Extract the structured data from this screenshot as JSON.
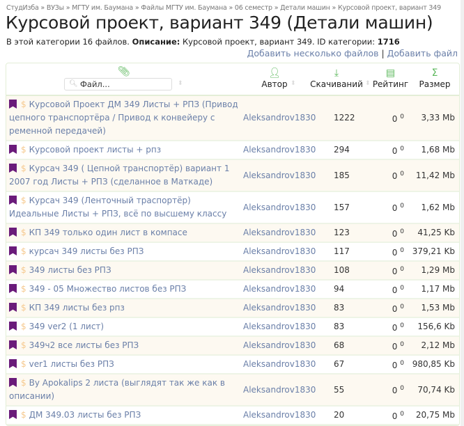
{
  "breadcrumb": [
    "СтудИзба",
    "ВУЗы",
    "МГТУ им. Баумана",
    "Файлы МГТУ им. Баумана",
    "06 семестр",
    "Детали машин",
    "Курсовой проект, вариант 349"
  ],
  "title": "Курсовой проект, вариант 349 (Детали машин)",
  "description": {
    "prefix": "В этой категории 16 файлов. ",
    "label": "Описание:",
    "text": " Курсовой проект, вариант 349. ID категории: ",
    "id": "1716"
  },
  "links": {
    "add_many": "Добавить несколько файлов",
    "sep": " | ",
    "add_one": "Добавить файл"
  },
  "table": {
    "search_placeholder": "Файл...",
    "headers": {
      "author": "Автор",
      "downloads": "Скачиваний",
      "rating": "Рейтинг",
      "size": "Размер"
    },
    "rows": [
      {
        "name": "Курсовой Проект ДМ 349 Листы + РПЗ (Привод цепного транспортёра / Привод к конвейеру с ременной передачей)",
        "author": "Aleksandrov1830",
        "downloads": "1222",
        "rating": "0",
        "votes": "0",
        "size": "3,33 Mb"
      },
      {
        "name": "Курсовой проект листы + рпз",
        "author": "Aleksandrov1830",
        "downloads": "294",
        "rating": "0",
        "votes": "0",
        "size": "1,68 Mb"
      },
      {
        "name": "Курсач 349 ( Цепной транспортёр) вариант 1 2007 год Листы + РПЗ (сделанное в Маткаде)",
        "author": "Aleksandrov1830",
        "downloads": "185",
        "rating": "0",
        "votes": "0",
        "size": "11,42 Mb"
      },
      {
        "name": "Курсач 349 (Ленточный траспортёр) Идеальные Листы + РПЗ, всё по высшему классу",
        "author": "Aleksandrov1830",
        "downloads": "157",
        "rating": "0",
        "votes": "0",
        "size": "1,62 Mb"
      },
      {
        "name": "КП 349 только один лист в компасе",
        "author": "Aleksandrov1830",
        "downloads": "123",
        "rating": "0",
        "votes": "0",
        "size": "41,25 Kb"
      },
      {
        "name": "курсач 349 листы без РПЗ",
        "author": "Aleksandrov1830",
        "downloads": "117",
        "rating": "0",
        "votes": "0",
        "size": "379,21 Kb"
      },
      {
        "name": "349 листы без РПЗ",
        "author": "Aleksandrov1830",
        "downloads": "108",
        "rating": "0",
        "votes": "0",
        "size": "1,29 Mb"
      },
      {
        "name": "349 - 05 Множество листов без РПЗ",
        "author": "Aleksandrov1830",
        "downloads": "94",
        "rating": "0",
        "votes": "0",
        "size": "1,17 Mb"
      },
      {
        "name": "КП 349 листы без рпз",
        "author": "Aleksandrov1830",
        "downloads": "83",
        "rating": "0",
        "votes": "0",
        "size": "1,53 Mb"
      },
      {
        "name": "349 ver2 (1 лист)",
        "author": "Aleksandrov1830",
        "downloads": "83",
        "rating": "0",
        "votes": "0",
        "size": "156,6 Kb"
      },
      {
        "name": "349ч2 все листы без РПЗ",
        "author": "Aleksandrov1830",
        "downloads": "68",
        "rating": "0",
        "votes": "0",
        "size": "2,12 Mb"
      },
      {
        "name": "ver1 листы без РПЗ",
        "author": "Aleksandrov1830",
        "downloads": "67",
        "rating": "0",
        "votes": "0",
        "size": "980,85 Kb"
      },
      {
        "name": "By Apokalips 2 листа (выглядят так же как в описании)",
        "author": "Aleksandrov1830",
        "downloads": "55",
        "rating": "0",
        "votes": "0",
        "size": "70,74 Kb"
      },
      {
        "name": "ДМ 349.03 листы без РПЗ",
        "author": "Aleksandrov1830",
        "downloads": "20",
        "rating": "0",
        "votes": "0",
        "size": "20,75 Mb"
      }
    ]
  }
}
